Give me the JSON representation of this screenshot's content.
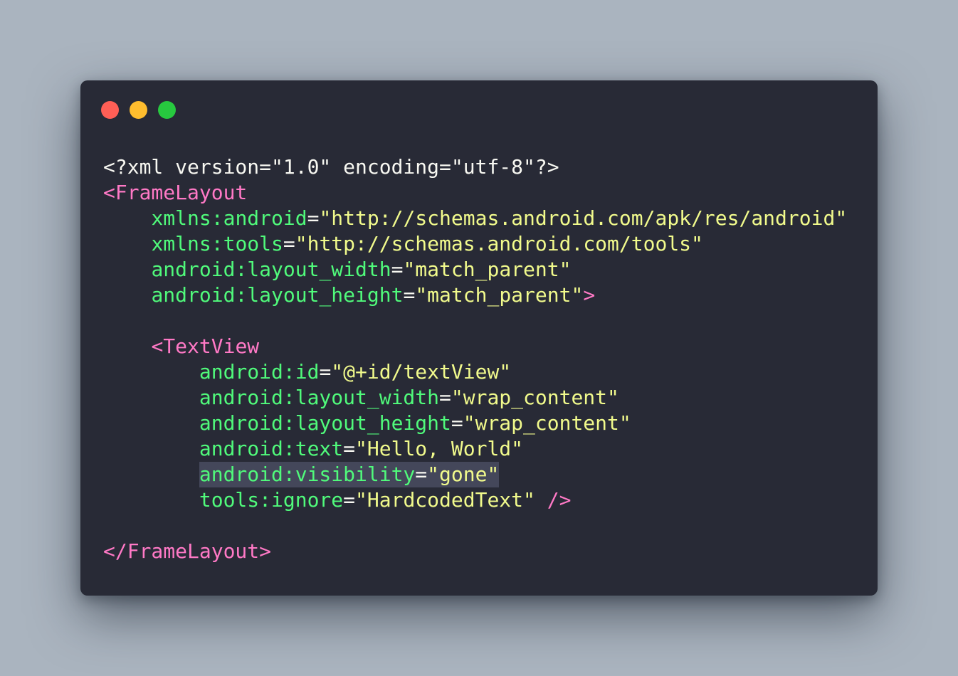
{
  "window": {
    "controls": [
      "close",
      "minimize",
      "zoom"
    ],
    "colors": {
      "close": "#ff5f56",
      "minimize": "#ffbd2e",
      "zoom": "#27c93f",
      "background": "#282a36"
    }
  },
  "code": {
    "theme_colors": {
      "tag": "#ff79c6",
      "attribute": "#50fa7b",
      "string": "#f1fa8c",
      "plain": "#f8f8f2",
      "highlight": "#44475a"
    },
    "declaration": "<?xml version=\"1.0\" encoding=\"utf-8\"?>",
    "frame_open": "<FrameLayout",
    "frame_attrs": [
      {
        "name": "xmlns:android",
        "eq": "=",
        "value": "\"http://schemas.android.com/apk/res/android\""
      },
      {
        "name": "xmlns:tools",
        "eq": "=",
        "value": "\"http://schemas.android.com/tools\""
      },
      {
        "name": "android:layout_width",
        "eq": "=",
        "value": "\"match_parent\""
      },
      {
        "name": "android:layout_height",
        "eq": "=",
        "value": "\"match_parent\"",
        "close": ">"
      }
    ],
    "textview_open": "<TextView",
    "textview_attrs": [
      {
        "name": "android:id",
        "eq": "=",
        "value": "\"@+id/textView\""
      },
      {
        "name": "android:layout_width",
        "eq": "=",
        "value": "\"wrap_content\""
      },
      {
        "name": "android:layout_height",
        "eq": "=",
        "value": "\"wrap_content\""
      },
      {
        "name": "android:text",
        "eq": "=",
        "value": "\"Hello, World\""
      },
      {
        "name": "android:visibility",
        "eq": "=",
        "value": "\"gone\"",
        "highlighted": true
      },
      {
        "name": "tools:ignore",
        "eq": "=",
        "value": "\"HardcodedText\"",
        "close": " />"
      }
    ],
    "frame_close": "</FrameLayout>"
  }
}
